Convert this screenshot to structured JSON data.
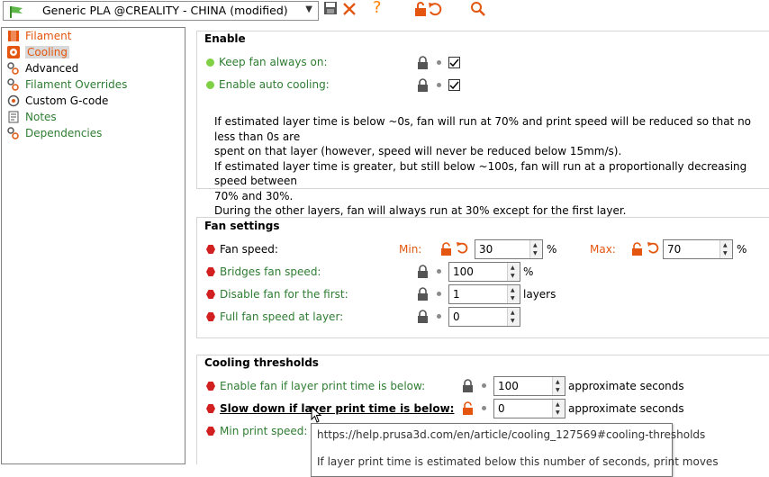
{
  "toolbar": {
    "preset_name": "Generic PLA @CREALITY - CHINA (modified)",
    "help_glyph": "?",
    "icons": [
      "save-icon",
      "delete-icon",
      "help-icon",
      "unlock-icon",
      "undo-icon",
      "search-icon"
    ]
  },
  "sidebar": {
    "items": [
      {
        "label": "Filament",
        "color": "#e4560f",
        "icon": "filament-icon"
      },
      {
        "label": "Cooling",
        "color": "#e4560f",
        "icon": "fan-icon",
        "selected": true
      },
      {
        "label": "Advanced",
        "color": "#000000",
        "icon": "advanced-icon"
      },
      {
        "label": "Filament Overrides",
        "color": "#2e7d32",
        "icon": "overrides-icon"
      },
      {
        "label": "Custom G-code",
        "color": "#000000",
        "icon": "gcode-icon"
      },
      {
        "label": "Notes",
        "color": "#2e7d32",
        "icon": "notes-icon"
      },
      {
        "label": "Dependencies",
        "color": "#2e7d32",
        "icon": "dependencies-icon"
      }
    ]
  },
  "enable": {
    "title": "Enable",
    "keep_fan_label": "Keep fan always on:",
    "auto_cooling_label": "Enable auto cooling:",
    "keep_fan_checked": true,
    "auto_cooling_checked": true,
    "description": [
      "If estimated layer time is below ~0s, fan will run at 70% and print speed will be reduced so that no less than 0s are",
      "spent on that layer (however, speed will never be reduced below 15mm/s).",
      "If estimated layer time is greater, but still below ~100s, fan will run at a proportionally decreasing speed between",
      "70% and 30%.",
      "During the other layers, fan will always run at 30% except for the first layer."
    ]
  },
  "fan_settings": {
    "title": "Fan settings",
    "fan_speed_label": "Fan speed:",
    "min_label": "Min:",
    "max_label": "Max:",
    "min_value": "30",
    "max_value": "70",
    "percent_unit": "%",
    "bridges_label": "Bridges fan speed:",
    "bridges_value": "100",
    "disable_first_label": "Disable fan for the first:",
    "disable_first_value": "1",
    "layers_unit": "layers",
    "full_speed_label": "Full fan speed at layer:",
    "full_speed_value": "0"
  },
  "cooling_thresholds": {
    "title": "Cooling thresholds",
    "enable_fan_label": "Enable fan if layer print time is below:",
    "enable_fan_value": "100",
    "slowdown_label": "Slow down if layer print time is below:",
    "slowdown_value": "0",
    "seconds_unit": "approximate seconds",
    "min_print_speed_label": "Min print speed:"
  },
  "tooltip": {
    "url": "https://help.prusa3d.com/en/article/cooling_127569#cooling-thresholds",
    "text": "If layer print time is estimated below this number of seconds, print moves"
  }
}
